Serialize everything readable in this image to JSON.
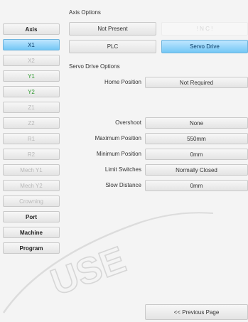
{
  "sidebar": {
    "axis_label": "Axis",
    "items": [
      "X1",
      "X2",
      "Y1",
      "Y2",
      "Z1",
      "Z2",
      "R1",
      "R2",
      "Mech Y1",
      "Mech Y2",
      "Crowning"
    ],
    "bottom": [
      "Port",
      "Machine",
      "Program"
    ]
  },
  "axis_options": {
    "title": "Axis Options",
    "not_present": "Not Present",
    "nc_placeholder": "! N C !",
    "plc": "PLC",
    "servo_drive": "Servo Drive"
  },
  "servo_options": {
    "title": "Servo Drive Options",
    "rows": [
      {
        "label": "Home Position",
        "value": "Not Required"
      },
      {
        "label": "Overshoot",
        "value": "None"
      },
      {
        "label": "Maximum Position",
        "value": "550mm"
      },
      {
        "label": "Minimum Position",
        "value": "0mm"
      },
      {
        "label": "Limit Switches",
        "value": "Normally Closed"
      },
      {
        "label": "Slow Distance",
        "value": "0mm"
      }
    ]
  },
  "footer": {
    "previous_page": "<< Previous Page"
  },
  "watermark": {
    "text": "USE"
  },
  "colors": {
    "accent": "#74c7f5",
    "green_text": "#2f9a2f",
    "disabled_text": "#b8b8b8"
  }
}
